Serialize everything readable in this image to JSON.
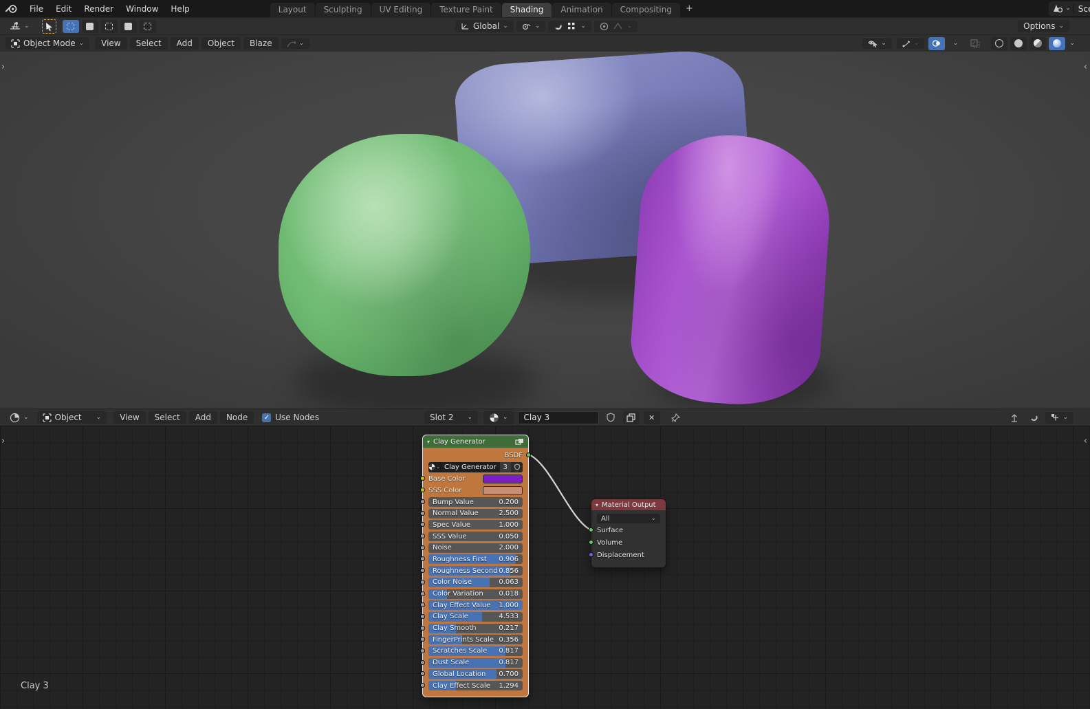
{
  "accent": "#4772b3",
  "topbar": {
    "menus": [
      {
        "label": "File"
      },
      {
        "label": "Edit"
      },
      {
        "label": "Render"
      },
      {
        "label": "Window"
      },
      {
        "label": "Help"
      }
    ],
    "tabs": [
      {
        "label": "Layout",
        "active": false
      },
      {
        "label": "Sculpting",
        "active": false
      },
      {
        "label": "UV Editing",
        "active": false
      },
      {
        "label": "Texture Paint",
        "active": false
      },
      {
        "label": "Shading",
        "active": true
      },
      {
        "label": "Animation",
        "active": false
      },
      {
        "label": "Compositing",
        "active": false
      }
    ],
    "new_tab_label": "+",
    "scene_label": "Scen"
  },
  "tool_settings": {
    "orientation": "Global",
    "options_label": "Options"
  },
  "viewport_header": {
    "mode": "Object Mode",
    "menus": [
      {
        "label": "View"
      },
      {
        "label": "Select"
      },
      {
        "label": "Add"
      },
      {
        "label": "Object"
      },
      {
        "label": "Blaze"
      }
    ]
  },
  "node_header": {
    "shader_type": "Object",
    "menus": [
      {
        "label": "View"
      },
      {
        "label": "Select"
      },
      {
        "label": "Add"
      },
      {
        "label": "Node"
      }
    ],
    "use_nodes_label": "Use Nodes",
    "check_glyph": "✓",
    "slot": "Slot 2",
    "material_name": "Clay 3",
    "close_glyph": "✕"
  },
  "node_editor": {
    "material_overlay_label": "Clay 3",
    "clay_node": {
      "title": "Clay Generator",
      "collapse_glyph": "▾",
      "output_label": "BSDF",
      "group_name": "Clay Generator",
      "user_count": "3",
      "color_inputs": [
        {
          "label": "Base Color",
          "color": "#7c1ec4"
        },
        {
          "label": "SSS Color",
          "color": "#c58d72"
        }
      ],
      "value_inputs": [
        {
          "label": "Bump Value",
          "value": "0.200",
          "fill": 0
        },
        {
          "label": "Normal Value",
          "value": "2.500",
          "fill": 0
        },
        {
          "label": "Spec Value",
          "value": "1.000",
          "fill": 0
        },
        {
          "label": "SSS Value",
          "value": "0.050",
          "fill": 0
        },
        {
          "label": "Noise",
          "value": "2.000",
          "fill": 0
        },
        {
          "label": "Roughness First",
          "value": "0.906",
          "fill": 0.93
        },
        {
          "label": "Roughness Second",
          "value": "0.856",
          "fill": 0.87
        },
        {
          "label": "Color Noise",
          "value": "0.063",
          "fill": 0.65
        },
        {
          "label": "Color Variation",
          "value": "0.018",
          "fill": 0.2
        },
        {
          "label": "Clay Effect Value",
          "value": "1.000",
          "fill": 1
        },
        {
          "label": "Clay Scale",
          "value": "4.533",
          "fill": 0.57
        },
        {
          "label": "Clay Smooth",
          "value": "0.217",
          "fill": 0.29
        },
        {
          "label": "FingerPrints Scale",
          "value": "0.356",
          "fill": 0.36
        },
        {
          "label": "Scratches Scale",
          "value": "0.817",
          "fill": 0.82
        },
        {
          "label": "Dust Scale",
          "value": "0.817",
          "fill": 0.82
        },
        {
          "label": "Global Location",
          "value": "0.700",
          "fill": 0.72
        },
        {
          "label": "Clay Effect Scale",
          "value": "1.294",
          "fill": 0.29
        }
      ]
    },
    "output_node": {
      "title": "Material Output",
      "collapse_glyph": "▾",
      "target": "All",
      "inputs": [
        {
          "label": "Surface",
          "socket": "#63c763"
        },
        {
          "label": "Volume",
          "socket": "#63c763"
        },
        {
          "label": "Displacement",
          "socket": "#6e6ad8"
        }
      ]
    }
  }
}
